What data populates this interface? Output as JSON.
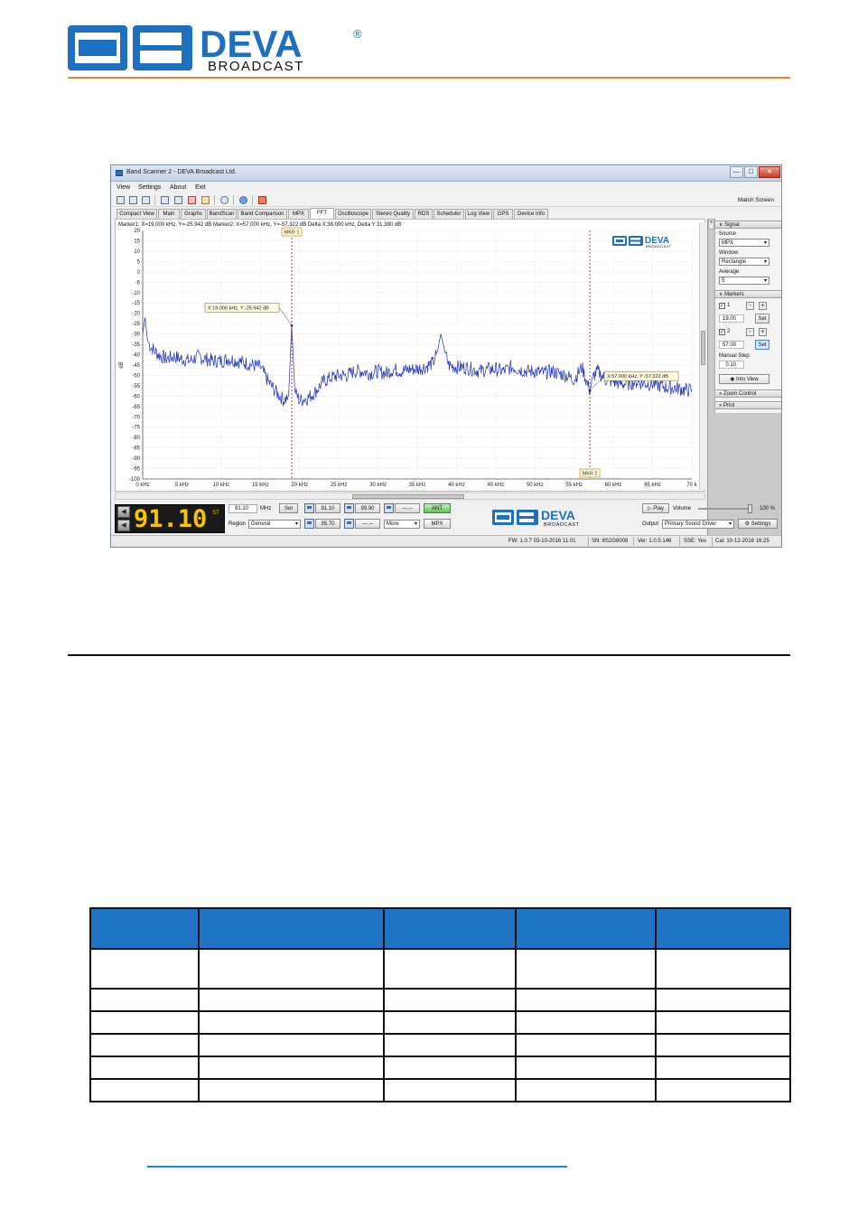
{
  "page_logo": {
    "letters": "DEVA",
    "registered": "®",
    "sub": "BROADCAST"
  },
  "window": {
    "title": "Band Scanner 2 - DEVA Broadcast Ltd.",
    "controls": {
      "min": "—",
      "max": "☐",
      "close": "✕"
    },
    "menu": [
      "View",
      "Settings",
      "About",
      "Exit"
    ],
    "match_screen": "Match Screen",
    "tabs": [
      "Compact View",
      "Main",
      "Graphs",
      "BandScan",
      "Band Comparison",
      "MPX",
      "FFT",
      "Oscilloscope",
      "Stereo Quality",
      "RDS",
      "Scheduler",
      "Log View",
      "GPS",
      "Device Info"
    ],
    "active_tab": "FFT",
    "marker_info": "Marker1: X=19.000 kHz, Y=-25.942 dB     Marker2: X=57.000 kHz, Y=-57.322 dB     Delta X:38.000 kHz, Delta Y:31.380 dB"
  },
  "chart_data": {
    "type": "line",
    "y_axis_label": "dB",
    "x_ticks": [
      "0 kHz",
      "5 kHz",
      "10 kHz",
      "15 kHz",
      "20 kHz",
      "25 kHz",
      "30 kHz",
      "35 kHz",
      "40 kHz",
      "45 kHz",
      "50 kHz",
      "55 kHz",
      "60 kHz",
      "65 kHz",
      "70 k"
    ],
    "y_ticks": [
      "20",
      "15",
      "10",
      "5",
      "0",
      "-5",
      "-10",
      "-15",
      "-20",
      "-25",
      "-30",
      "-35",
      "-40",
      "-45",
      "-50",
      "-55",
      "-60",
      "-65",
      "-70",
      "-75",
      "-80",
      "-85",
      "-90",
      "-95",
      "-100"
    ],
    "xlim": [
      0,
      70
    ],
    "ylim": [
      -100,
      20
    ],
    "grid": true,
    "series_color": "#1c2fbf",
    "series": [
      {
        "x": [
          0,
          0.3,
          0.6,
          1,
          2,
          3,
          4,
          5,
          6,
          7,
          8,
          9,
          10,
          11,
          12,
          13,
          14,
          15,
          16,
          17,
          18,
          18.6,
          19,
          19.4,
          20,
          21,
          22,
          23,
          24,
          25,
          26,
          27,
          28,
          29,
          30,
          31,
          32,
          33,
          34,
          35,
          36,
          37,
          37.6,
          38,
          38.5,
          39,
          40,
          41,
          42,
          43,
          44,
          45,
          46,
          47,
          48,
          49,
          50,
          51,
          52,
          53,
          54,
          55,
          56,
          56.5,
          57,
          57.5,
          58,
          59,
          60,
          61,
          62,
          63,
          64,
          65,
          66,
          67,
          68,
          69,
          70
        ],
        "y": [
          -30,
          -22,
          -33,
          -36,
          -40,
          -42,
          -41,
          -42,
          -43,
          -41,
          -42,
          -43,
          -43,
          -42,
          -43,
          -44,
          -45,
          -46,
          -53,
          -58,
          -62,
          -60,
          -25.9,
          -58,
          -62,
          -61,
          -58,
          -53,
          -51,
          -50,
          -50,
          -48,
          -48,
          -49,
          -48,
          -49,
          -47,
          -48,
          -47,
          -47,
          -46,
          -44,
          -38,
          -30,
          -38,
          -45,
          -46,
          -46,
          -47,
          -48,
          -47,
          -47,
          -48,
          -46,
          -47,
          -48,
          -48,
          -49,
          -48,
          -49,
          -50,
          -52,
          -46,
          -52,
          -57.3,
          -50,
          -48,
          -52,
          -53,
          -54,
          -54,
          -53,
          -54,
          -54,
          -55,
          -56,
          -56,
          -57,
          -57
        ]
      }
    ],
    "markers": [
      {
        "label": "MKR 1",
        "x": 19,
        "y": -25.942,
        "tooltip": "X:19.000 kHz, Y:-25.942 dB"
      },
      {
        "label": "MKR 2",
        "x": 57,
        "y": -57.322,
        "tooltip": "X:57.000 kHz, Y:-57.322 dB"
      }
    ]
  },
  "panel": {
    "expander": "»",
    "signal": {
      "header": "Signal",
      "source_label": "Source",
      "source_value": "MPX",
      "window_label": "Window",
      "window_value": "Rectangle",
      "average_label": "Average",
      "average_value": "5"
    },
    "markers": {
      "header": "Markers",
      "m1_label": "1",
      "m1_value": "19.00",
      "m2_label": "2",
      "m2_value": "57.00",
      "minus": "-",
      "plus": "+",
      "set": "Set",
      "manual_step_label": "Manual Step",
      "manual_step_value": "0.10",
      "into_view": "Into View"
    },
    "zoom_control": "Zoom Control",
    "print": "Print"
  },
  "bottom": {
    "lcd_freq": "91.10",
    "lcd_badge": "ST",
    "freq_value": "91.10",
    "freq_unit": "MHz",
    "set": "Set",
    "region_label": "Region",
    "region_value": "General",
    "preset1": "91.10",
    "preset2": "99.90",
    "preset3": "---.--",
    "preset4": "95.70",
    "preset5": "---.--",
    "more": "More",
    "ant": "ANT",
    "mpx": "MPX",
    "play": "Play",
    "volume_label": "Volume",
    "volume_value": "100 %",
    "volume_level": 0.95,
    "output_label": "Output",
    "output_value": "Primary Sound Driver",
    "settings": "Settings"
  },
  "statusbar": {
    "fw": "FW: 1.0.7 03-10-2016 11:01",
    "sn": "SN: 8S2G8008",
    "ver": "Ver: 1.0.5.146",
    "sse": "SSE: Yes",
    "cal": "Cal: 10-12-2016 16:25"
  }
}
